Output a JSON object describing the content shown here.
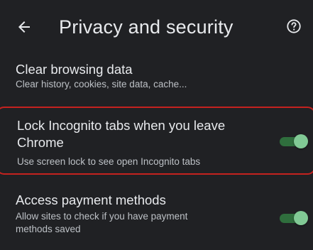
{
  "app_bar": {
    "back_icon": "arrow-back-icon",
    "title": "Privacy and security",
    "help_icon": "help-circle-icon"
  },
  "settings": [
    {
      "title": "Clear browsing data",
      "subtitle": "Clear history, cookies, site data, cache..."
    },
    {
      "title_line1": "Lock Incognito tabs when you leave",
      "title_line2": "Chrome",
      "subtitle": "Use screen lock to see open Incognito tabs",
      "toggle_on": true
    },
    {
      "title": "Access payment methods",
      "subtitle_line1": "Allow sites to check if you have payment",
      "subtitle_line2": "methods saved",
      "toggle_on": true
    }
  ],
  "colors": {
    "background": "#202124",
    "text_primary": "#e8eaed",
    "text_secondary": "#bdc1c6",
    "toggle_thumb": "#81c995",
    "toggle_track": "#2f6e3d",
    "highlight_border": "#c5221f"
  }
}
